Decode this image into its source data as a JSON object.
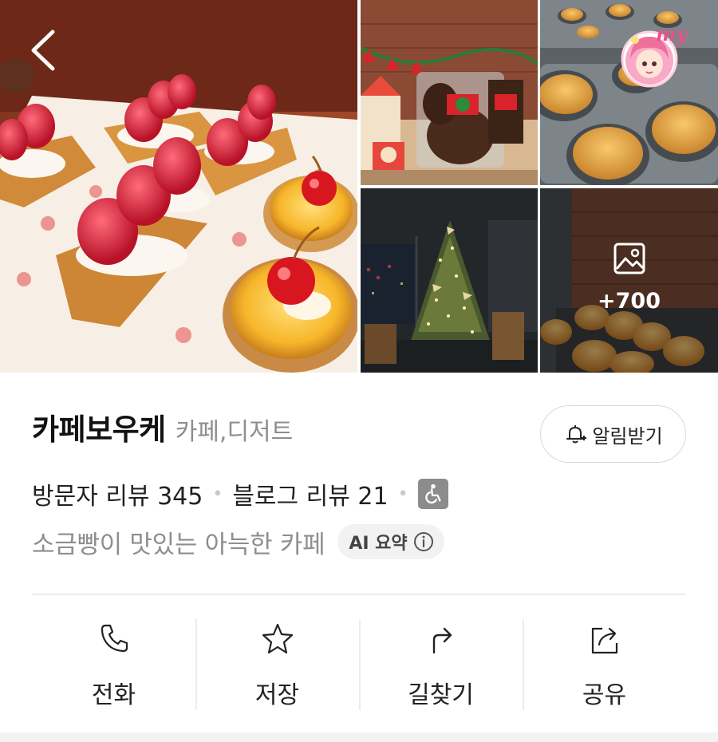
{
  "gallery": {
    "more_count": "+700",
    "photos": [
      {
        "subject": "strawberry-waffle-and-egg-tart-pastries"
      },
      {
        "subject": "christmas-gift-box-display"
      },
      {
        "subject": "madeleines-in-baking-tray"
      },
      {
        "subject": "christmas-tree-night-view"
      },
      {
        "subject": "salt-bread-rolls"
      }
    ],
    "avatar_text": "my"
  },
  "place": {
    "name": "카페보우케",
    "category": "카페,디저트"
  },
  "alert_button": {
    "label": "알림받기"
  },
  "reviews": {
    "visitor": "방문자 리뷰 345",
    "blog": "블로그 리뷰 21"
  },
  "summary": {
    "text": "소금빵이 맛있는 아늑한 카페",
    "ai_label": "AI 요약"
  },
  "actions": [
    {
      "label": "전화",
      "icon": "phone-icon"
    },
    {
      "label": "저장",
      "icon": "star-icon"
    },
    {
      "label": "길찾기",
      "icon": "directions-icon"
    },
    {
      "label": "공유",
      "icon": "share-icon"
    }
  ],
  "colors": {
    "text_primary": "#111111",
    "text_secondary": "#8e8e8e",
    "divider": "#ececec",
    "chip_bg": "#f2f2f2"
  }
}
